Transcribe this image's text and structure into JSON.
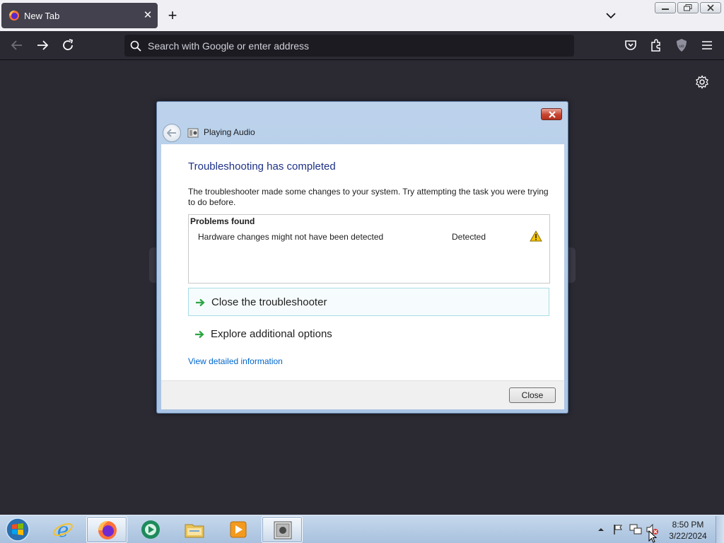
{
  "browser": {
    "tab_title": "New Tab",
    "tab_close_glyph": "✕",
    "new_tab_glyph": "+",
    "search_placeholder": "Search with Google or enter address",
    "icons": [
      "firefox-icon",
      "back-arrow-icon",
      "forward-arrow-icon",
      "reload-icon",
      "search-icon",
      "pocket-icon",
      "extensions-icon",
      "ublock-shield-icon",
      "hamburger-menu-icon",
      "settings-gear-icon",
      "tab-list-chevron-icon"
    ]
  },
  "dialog": {
    "title": "Playing Audio",
    "heading": "Troubleshooting has completed",
    "description": "The troubleshooter made some changes to your system. Try attempting the task you were trying to do before.",
    "problems_header": "Problems found",
    "problems": [
      {
        "name": "Hardware changes might not have been detected",
        "status": "Detected",
        "icon": "warning-icon"
      }
    ],
    "commands": [
      {
        "label": "Close the troubleshooter",
        "highlighted": true
      },
      {
        "label": "Explore additional options",
        "highlighted": false
      }
    ],
    "detail_link": "View detailed information",
    "close_button": "Close"
  },
  "taskbar": {
    "items": [
      "internet-explorer-icon",
      "firefox-icon",
      "media-center-icon",
      "file-explorer-icon",
      "media-player-icon",
      "troubleshooter-icon"
    ],
    "active_item": "troubleshooter-icon",
    "time": "8:50 PM",
    "date": "3/22/2024"
  },
  "colors": {
    "heading_blue": "#1e3287",
    "link_blue": "#0066cc",
    "arrow_green": "#2da544",
    "warning_yellow": "#f5c400"
  }
}
